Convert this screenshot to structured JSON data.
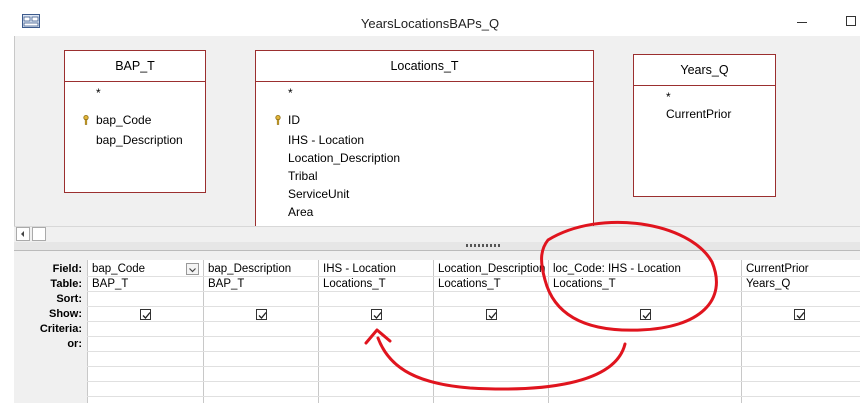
{
  "window": {
    "title": "YearsLocationsBAPs_Q",
    "icons": [
      "query-app-icon",
      "minimize-icon",
      "maximize-icon"
    ]
  },
  "tables": [
    {
      "name": "BAP_T",
      "fields": [
        "*",
        "bap_Code",
        "bap_Description"
      ],
      "key_field": "bap_Code"
    },
    {
      "name": "Locations_T",
      "fields": [
        "*",
        "ID",
        "IHS - Location",
        "Location_Description",
        "Tribal",
        "ServiceUnit",
        "Area"
      ],
      "key_field": "ID"
    },
    {
      "name": "Years_Q",
      "fields": [
        "*",
        "CurrentPrior"
      ],
      "key_field": ""
    }
  ],
  "grid": {
    "row_labels": [
      "Field:",
      "Table:",
      "Sort:",
      "Show:",
      "Criteria:",
      "or:"
    ],
    "columns": [
      {
        "field": "bap_Code",
        "table": "BAP_T",
        "show": true
      },
      {
        "field": "bap_Description",
        "table": "BAP_T",
        "show": true
      },
      {
        "field": "IHS - Location",
        "table": "Locations_T",
        "show": true
      },
      {
        "field": "Location_Description",
        "table": "Locations_T",
        "show": true
      },
      {
        "field": "loc_Code: IHS - Location",
        "table": "Locations_T",
        "show": true
      },
      {
        "field": "CurrentPrior",
        "table": "Years_Q",
        "show": true
      }
    ]
  },
  "annotation": {
    "color": "#e0141e",
    "shapes": [
      "circle-around-column",
      "curved-arrow-to-show-checkbox"
    ]
  }
}
